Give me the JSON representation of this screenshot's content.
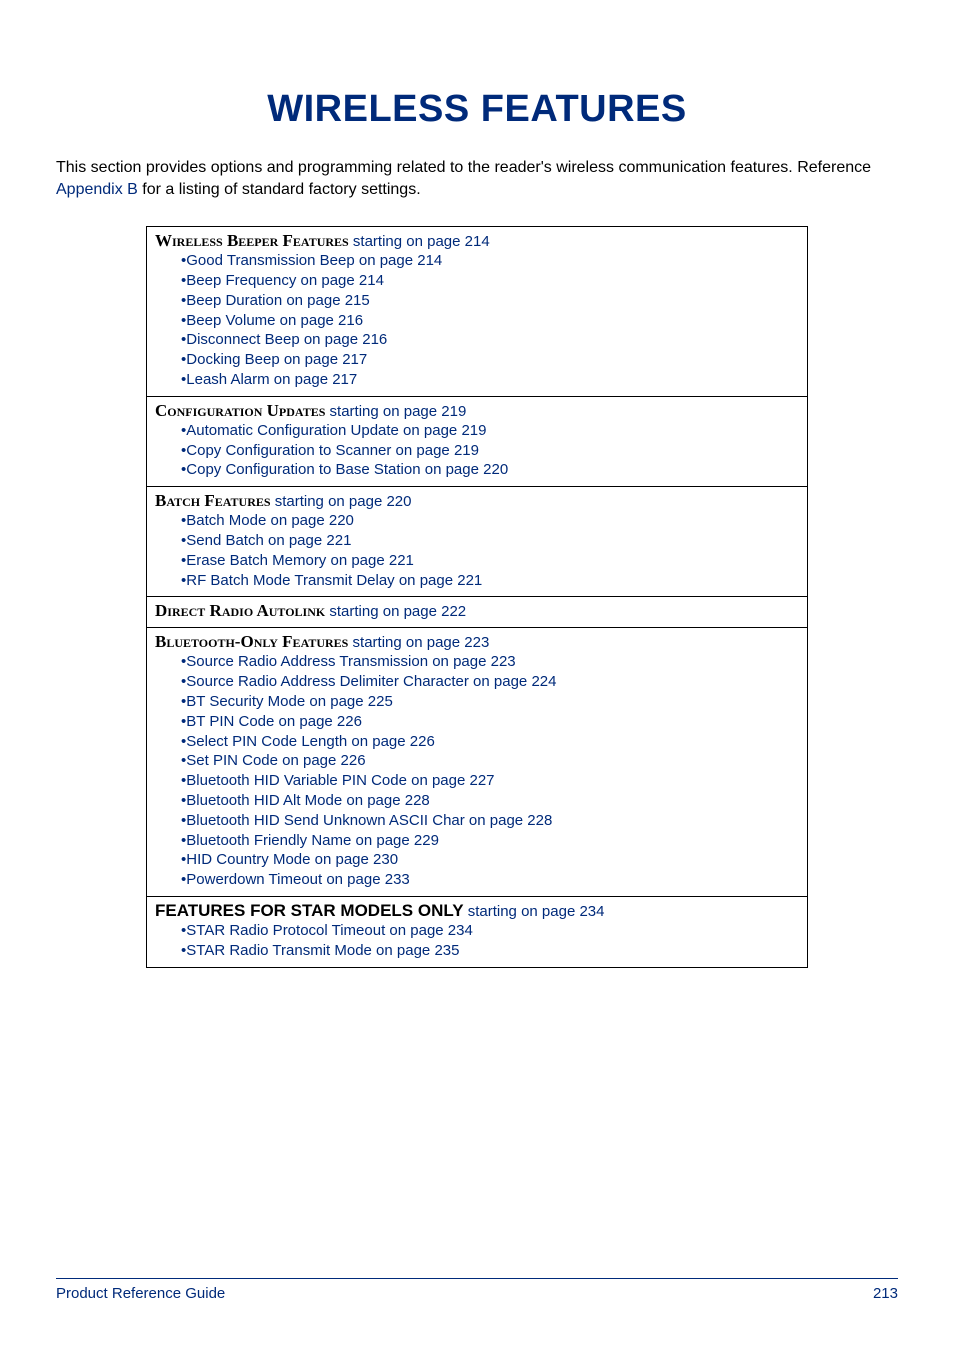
{
  "title": "WIRELESS FEATURES",
  "intro_part1": "This section provides options and programming related to the reader's wireless communication features. Reference ",
  "intro_link": "Appendix B",
  "intro_part2": " for a listing of standard factory settings.",
  "sections": [
    {
      "heading_name": "Wireless Beeper Features",
      "heading_link": " starting on page 214",
      "items": [
        "Good Transmission Beep on page 214",
        "Beep Frequency on page 214",
        "Beep Duration on page 215",
        "Beep Volume on page 216",
        "Disconnect Beep on page 216",
        "Docking Beep on page 217",
        "Leash Alarm on page 217"
      ]
    },
    {
      "heading_name": "Configuration Updates",
      "heading_link": " starting on page 219",
      "items": [
        "Automatic Configuration Update on page 219",
        "Copy Configuration to Scanner on page 219",
        "Copy Configuration to Base Station on page 220"
      ]
    },
    {
      "heading_name": "Batch Features",
      "heading_link": " starting on page 220",
      "items": [
        "Batch Mode on page 220",
        "Send Batch on page 221",
        "Erase Batch Memory on page 221",
        "RF Batch Mode Transmit Delay on page 221"
      ]
    },
    {
      "heading_name": "Direct Radio Autolink",
      "heading_link": " starting on page 222",
      "items": []
    },
    {
      "heading_name": "Bluetooth-Only Features",
      "heading_link": " starting on page 223",
      "items": [
        "Source Radio Address Transmission on page 223",
        "Source Radio Address Delimiter Character on page 224",
        "BT Security Mode on page 225",
        "BT PIN Code on page 226",
        "Select PIN Code Length on page 226",
        "Set PIN Code on page 226",
        "Bluetooth HID Variable PIN Code on page 227",
        "Bluetooth HID Alt Mode on page 228",
        "Bluetooth HID Send Unknown ASCII Char on page 228",
        "Bluetooth Friendly Name on page 229",
        "HID Country Mode on page 230",
        "Powerdown Timeout on page 233"
      ]
    },
    {
      "heading_name": "FEATURES FOR STAR MODELS ONLY",
      "heading_link": " starting on page 234",
      "items": [
        "STAR Radio Protocol Timeout on page 234",
        "STAR Radio Transmit Mode on page 235"
      ]
    }
  ],
  "footer": {
    "left": "Product Reference Guide",
    "right": "213"
  }
}
